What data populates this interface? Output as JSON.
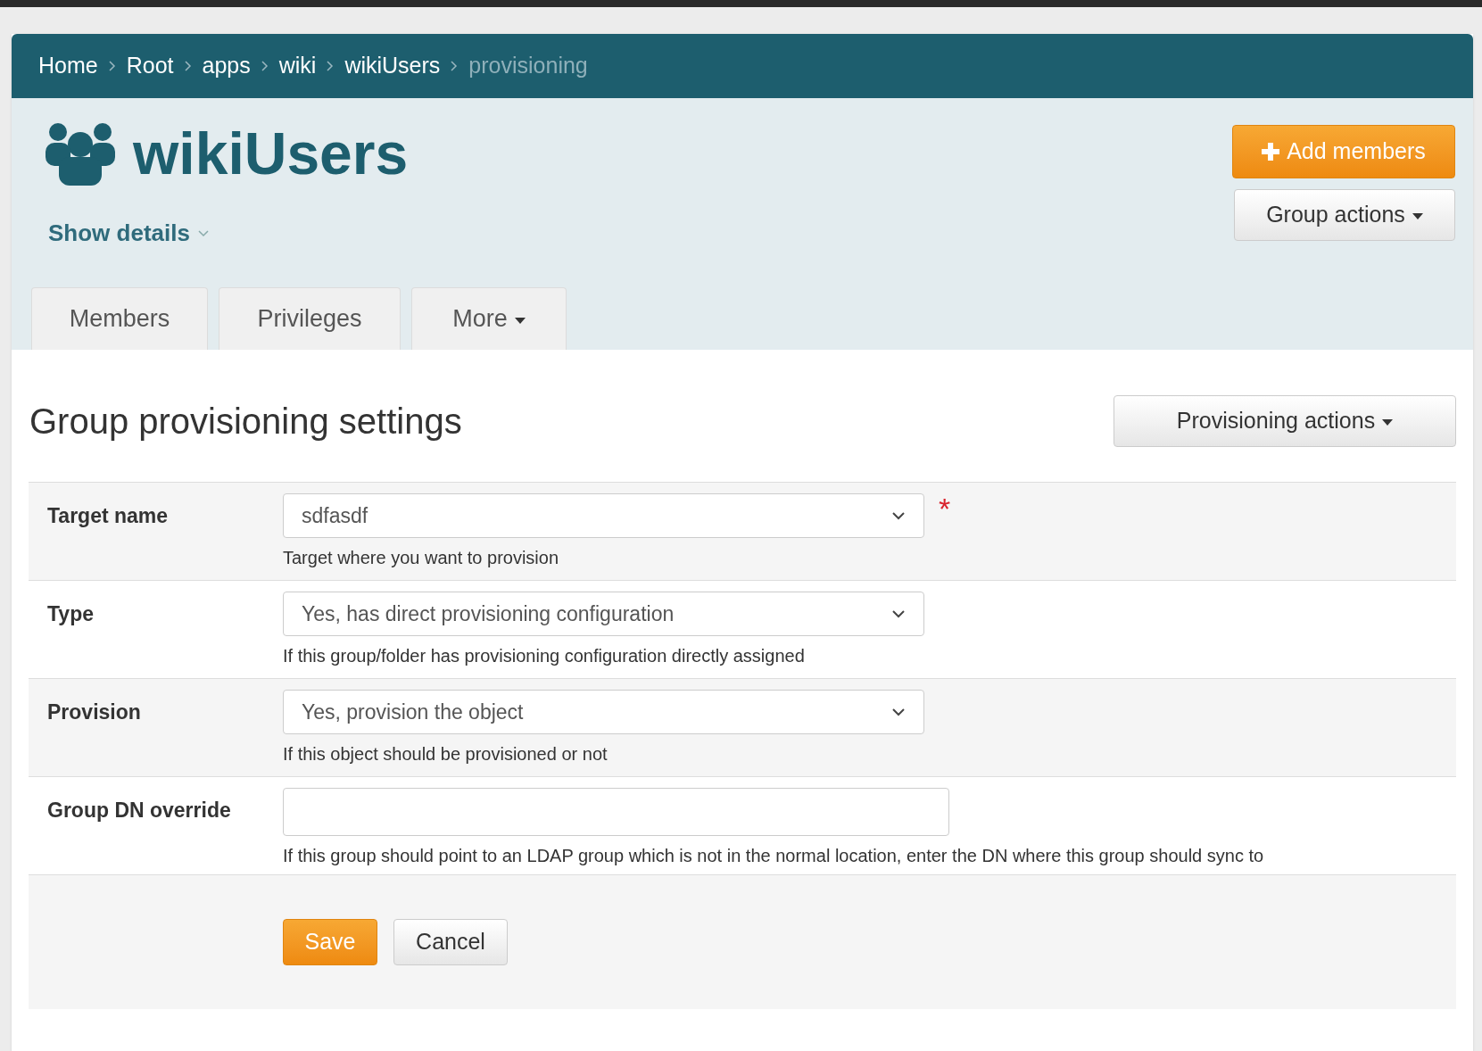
{
  "breadcrumb": [
    {
      "label": "Home",
      "current": false
    },
    {
      "label": "Root",
      "current": false
    },
    {
      "label": "apps",
      "current": false
    },
    {
      "label": "wiki",
      "current": false
    },
    {
      "label": "wikiUsers",
      "current": false
    },
    {
      "label": "provisioning",
      "current": true
    }
  ],
  "header": {
    "title": "wikiUsers",
    "show_details": "Show details",
    "add_button": "Add members",
    "group_actions": "Group actions"
  },
  "tabs": [
    {
      "label": "Members",
      "kind": "plain"
    },
    {
      "label": "Privileges",
      "kind": "plain"
    },
    {
      "label": "More",
      "kind": "dropdown"
    }
  ],
  "section": {
    "title": "Group provisioning settings",
    "actions": "Provisioning actions"
  },
  "fields": [
    {
      "label": "Target name",
      "kind": "select",
      "value": "sdfasdf",
      "hint": "Target where you want to provision",
      "required_mark": "*"
    },
    {
      "label": "Type",
      "kind": "select",
      "value": "Yes, has direct provisioning configuration",
      "hint": "If this group/folder has provisioning configuration directly assigned"
    },
    {
      "label": "Provision",
      "kind": "select",
      "value": "Yes, provision the object",
      "hint": "If this object should be provisioned or not"
    },
    {
      "label": "Group DN override",
      "kind": "text",
      "hint": "If this group should point to an LDAP group which is not in the normal location, enter the DN where this group should sync to"
    }
  ],
  "buttons": {
    "save": "Save",
    "cancel": "Cancel"
  }
}
